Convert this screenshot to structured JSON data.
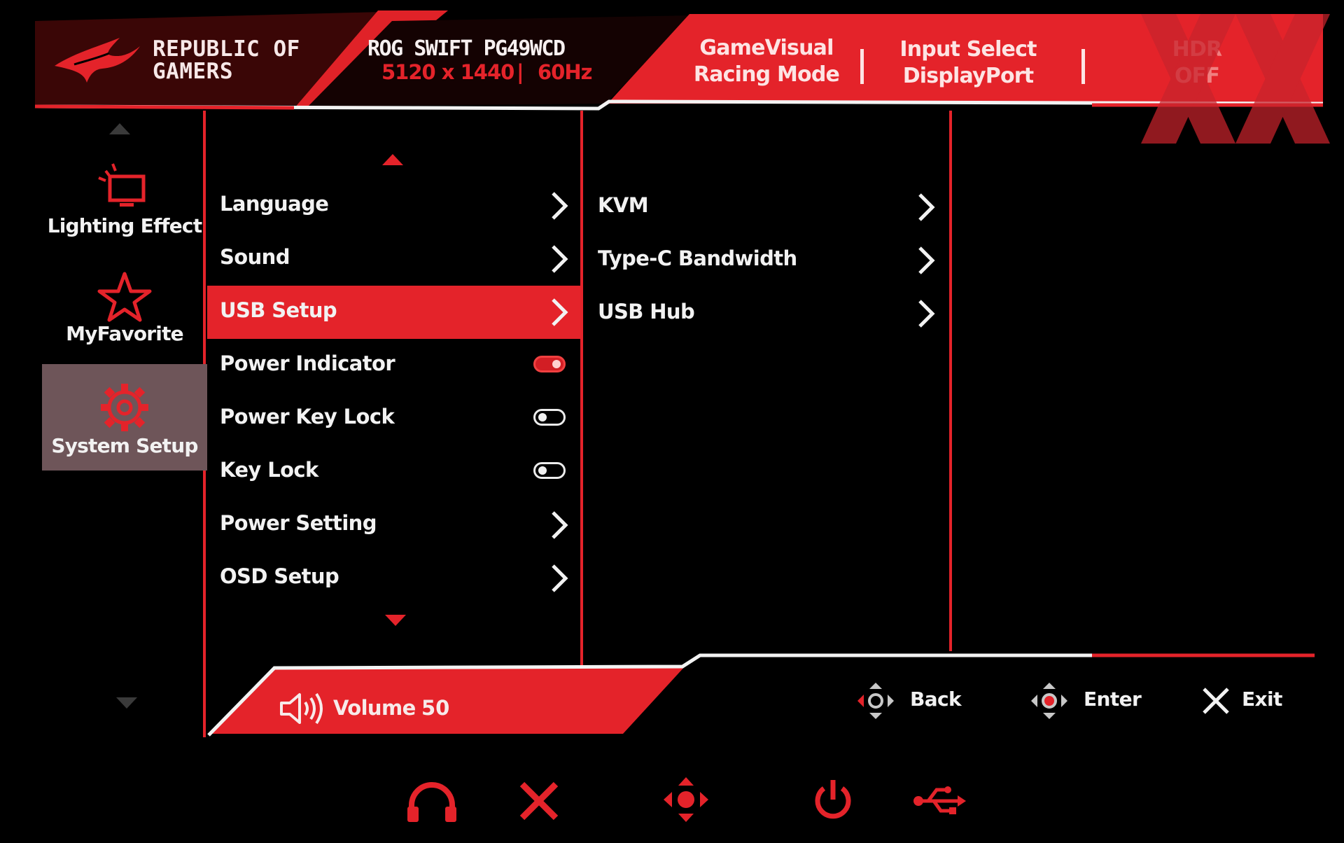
{
  "header": {
    "brand_line1": "REPUBLIC OF",
    "brand_line2": "GAMERS",
    "model": "ROG SWIFT PG49WCD",
    "resolution": "5120 x 1440",
    "separator": "|",
    "refresh": "60Hz",
    "gamevisual_label": "GameVisual",
    "gamevisual_value": "Racing Mode",
    "input_label": "Input Select",
    "input_value": "DisplayPort",
    "hdr_label": "HDR",
    "hdr_value": "OFF"
  },
  "categories": [
    {
      "label": "Lighting Effect",
      "icon": "monitor-light-icon",
      "selected": false
    },
    {
      "label": "MyFavorite",
      "icon": "star-icon",
      "selected": false
    },
    {
      "label": "System Setup",
      "icon": "gear-icon",
      "selected": true
    }
  ],
  "menu": [
    {
      "label": "Language",
      "control": "chevron"
    },
    {
      "label": "Sound",
      "control": "chevron"
    },
    {
      "label": "USB Setup",
      "control": "chevron",
      "selected": true
    },
    {
      "label": "Power Indicator",
      "control": "toggle",
      "on": true
    },
    {
      "label": "Power Key Lock",
      "control": "toggle",
      "on": false
    },
    {
      "label": "Key Lock",
      "control": "toggle",
      "on": false
    },
    {
      "label": "Power Setting",
      "control": "chevron"
    },
    {
      "label": "OSD Setup",
      "control": "chevron"
    }
  ],
  "submenu": [
    {
      "label": "KVM"
    },
    {
      "label": "Type-C Bandwidth"
    },
    {
      "label": "USB Hub"
    }
  ],
  "volume": {
    "label": "Volume",
    "value": "50"
  },
  "nav": {
    "back": "Back",
    "enter": "Enter",
    "exit": "Exit"
  },
  "colors": {
    "accent": "#e4232a",
    "selected_category": "#6e5559",
    "background": "#000000"
  },
  "hardware_icons": [
    "headphone-icon",
    "close-icon",
    "joystick-icon",
    "power-icon",
    "usb-icon"
  ]
}
